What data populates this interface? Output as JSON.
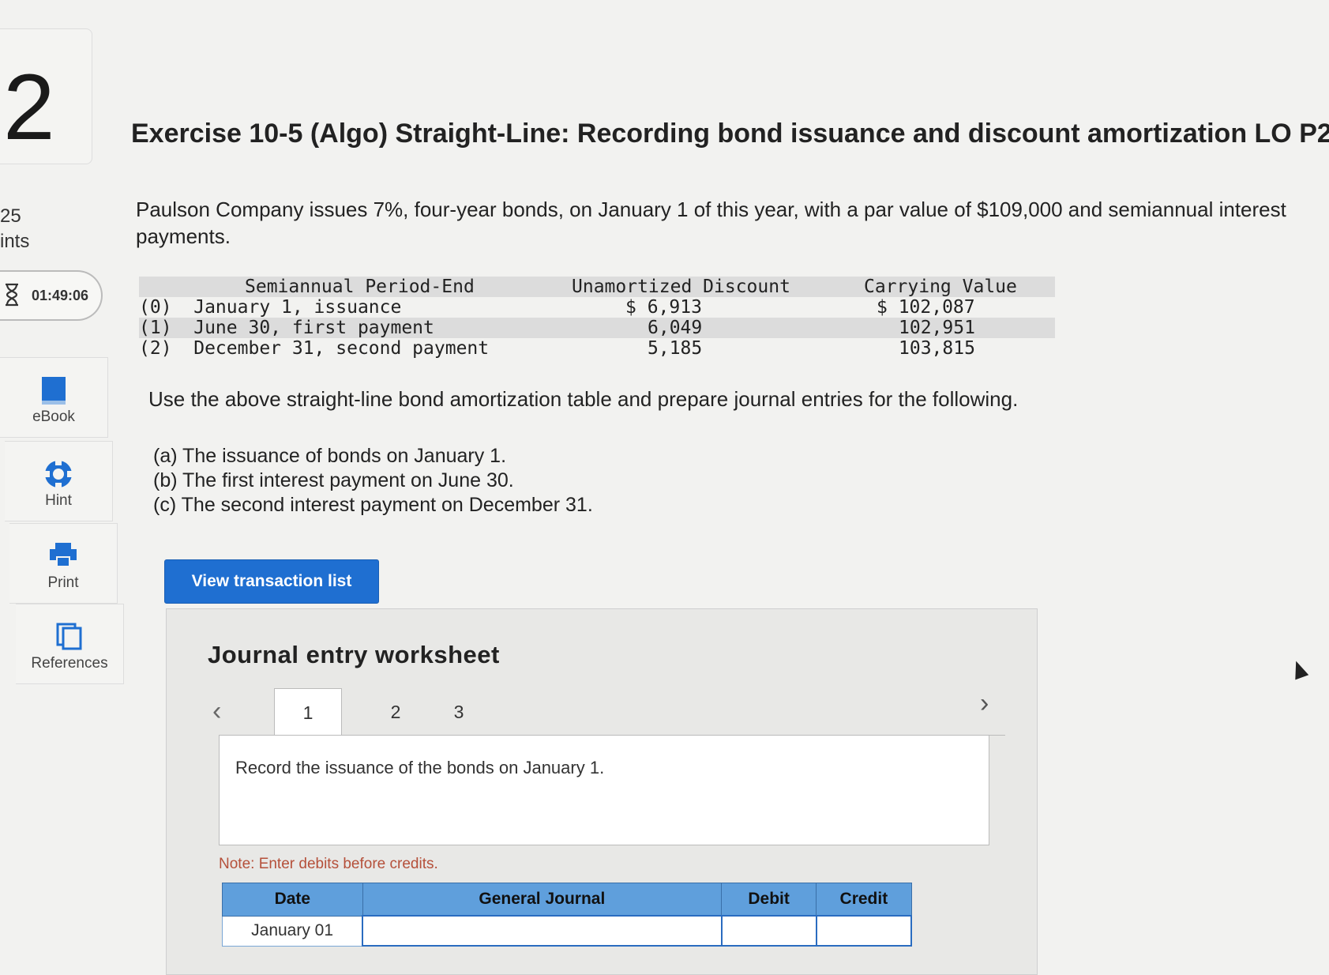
{
  "sidebar": {
    "question_number": "2",
    "points_value": "25",
    "points_label": "ints",
    "timer": "01:49:06",
    "tools": [
      {
        "label": "eBook",
        "icon": "book-icon"
      },
      {
        "label": "Hint",
        "icon": "lifebuoy-icon"
      },
      {
        "label": "Print",
        "icon": "printer-icon"
      },
      {
        "label": "References",
        "icon": "documents-icon"
      }
    ]
  },
  "exercise": {
    "title": "Exercise 10-5 (Algo) Straight-Line: Recording bond issuance and discount amortization LO P2",
    "intro": "Paulson Company issues 7%, four-year bonds, on January 1 of this year, with a par value of $109,000 and semiannual interest payments.",
    "instructions": "Use the above straight-line bond amortization table and prepare journal entries for the following.",
    "parts": [
      "(a) The issuance of bonds on January 1.",
      "(b) The first interest payment on June 30.",
      "(c) The second interest payment on December 31."
    ]
  },
  "amortization_table": {
    "headers": [
      "Semiannual Period-End",
      "Unamortized Discount",
      "Carrying Value"
    ],
    "rows": [
      {
        "period": "(0)  January 1, issuance",
        "discount": "$ 6,913",
        "carrying": "$ 102,087"
      },
      {
        "period": "(1)  June 30, first payment",
        "discount": "6,049",
        "carrying": "102,951"
      },
      {
        "period": "(2)  December 31, second payment",
        "discount": "5,185",
        "carrying": "103,815"
      }
    ]
  },
  "view_button": "View transaction list",
  "worksheet": {
    "title": "Journal entry worksheet",
    "tabs": [
      "1",
      "2",
      "3"
    ],
    "active_tab": "1",
    "description": "Record the issuance of the bonds on January 1.",
    "note": "Note: Enter debits before credits.",
    "table_headers": {
      "date": "Date",
      "journal": "General Journal",
      "debit": "Debit",
      "credit": "Credit"
    },
    "first_row_date": "January 01"
  }
}
